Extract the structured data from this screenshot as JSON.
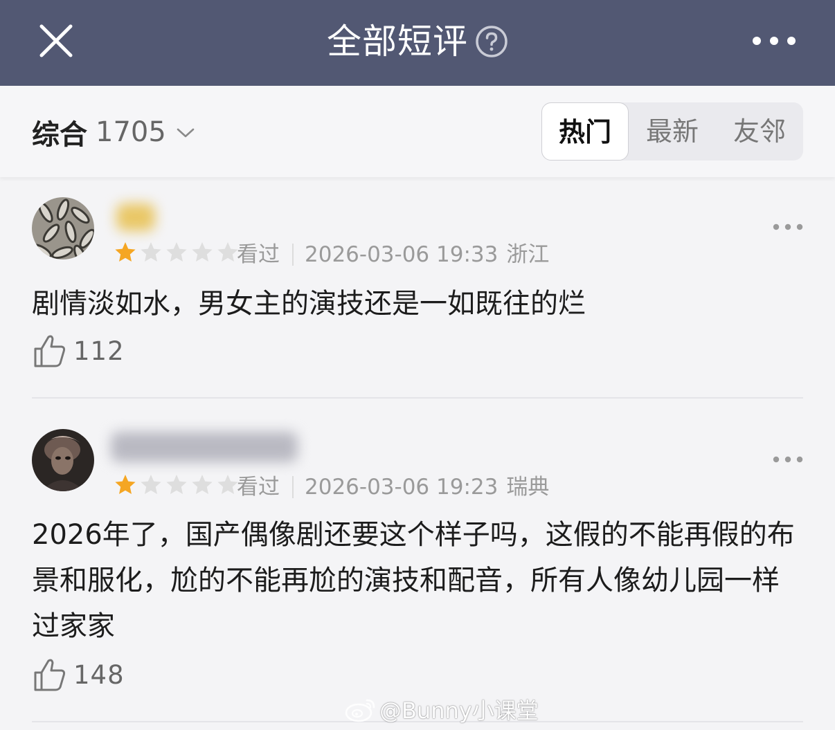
{
  "header": {
    "title": "全部短评",
    "close_icon": "close-icon",
    "help_icon": "question-circle-icon",
    "more_icon": "more-horizontal-icon",
    "background": "#525873"
  },
  "filter": {
    "sort_label": "综合",
    "total_count": "1705",
    "tabs": [
      {
        "label": "热门",
        "active": true
      },
      {
        "label": "最新",
        "active": false
      },
      {
        "label": "友邻",
        "active": false
      }
    ]
  },
  "comments": [
    {
      "rating": 1,
      "rating_max": 5,
      "status": "看过",
      "datetime": "2026-03-06 19:33",
      "location": "浙江",
      "text": "剧情淡如水，男女主的演技还是一如既往的烂",
      "likes": "112"
    },
    {
      "rating": 1,
      "rating_max": 5,
      "status": "看过",
      "datetime": "2026-03-06 19:23",
      "location": "瑞典",
      "text": "2026年了，国产偶像剧还要这个样子吗，这假的不能再假的布景和服化，尬的不能再尬的演技和配音，所有人像幼儿园一样过家家",
      "likes": "148"
    }
  ],
  "watermark": "@Bunny小课堂",
  "colors": {
    "star_filled": "#f5a623",
    "star_empty": "#dedede"
  }
}
